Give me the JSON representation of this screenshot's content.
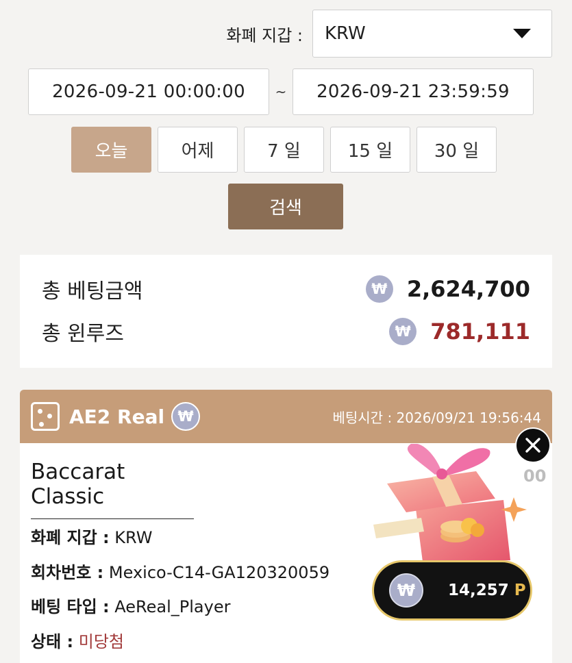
{
  "filter": {
    "wallet_label": "화폐 지갑 :",
    "wallet_value": "KRW",
    "date_from": "2026-09-21 00:00:00",
    "date_separator": "~",
    "date_to": "2026-09-21 23:59:59",
    "periods": [
      "오늘",
      "어제",
      "7 일",
      "15 일",
      "30 일"
    ],
    "active_period": "오늘",
    "search_label": "검색"
  },
  "summary": {
    "total_bet_label": "총 베팅금액",
    "total_bet_currency": "₩",
    "total_bet_value": "2,624,700",
    "win_loss_label": "총 윈루즈",
    "win_loss_currency": "₩",
    "win_loss_value": "781,111",
    "win_loss_color": "#9c2a2a"
  },
  "bet": {
    "provider": "AE2 Real",
    "currency_symbol": "₩",
    "time_label": "베팅시간 : 2026/09/21 19:56:44",
    "game_title": "Baccarat Classic",
    "amount_partial": "00",
    "wallet_key": "화폐 지갑 :",
    "wallet_value": "KRW",
    "round_key": "회차번호 :",
    "round_value": "Mexico-C14-GA120320059",
    "type_key": "베팅 타입 :",
    "type_value": "AeReal_Player",
    "status_key": "상태 :",
    "status_value": "미당첨",
    "status_color": "#a23a3a"
  },
  "promo": {
    "coin_symbol": "₩",
    "points": "14,257",
    "points_unit": "P",
    "icons": [
      "gift-box-icon",
      "close-icon"
    ]
  },
  "colors": {
    "accent": "#c69d79",
    "active_period": "#c7a68b",
    "search_button": "#8b6e55",
    "won_coin": "#a9adc9",
    "pill_border": "#e6c76a"
  }
}
